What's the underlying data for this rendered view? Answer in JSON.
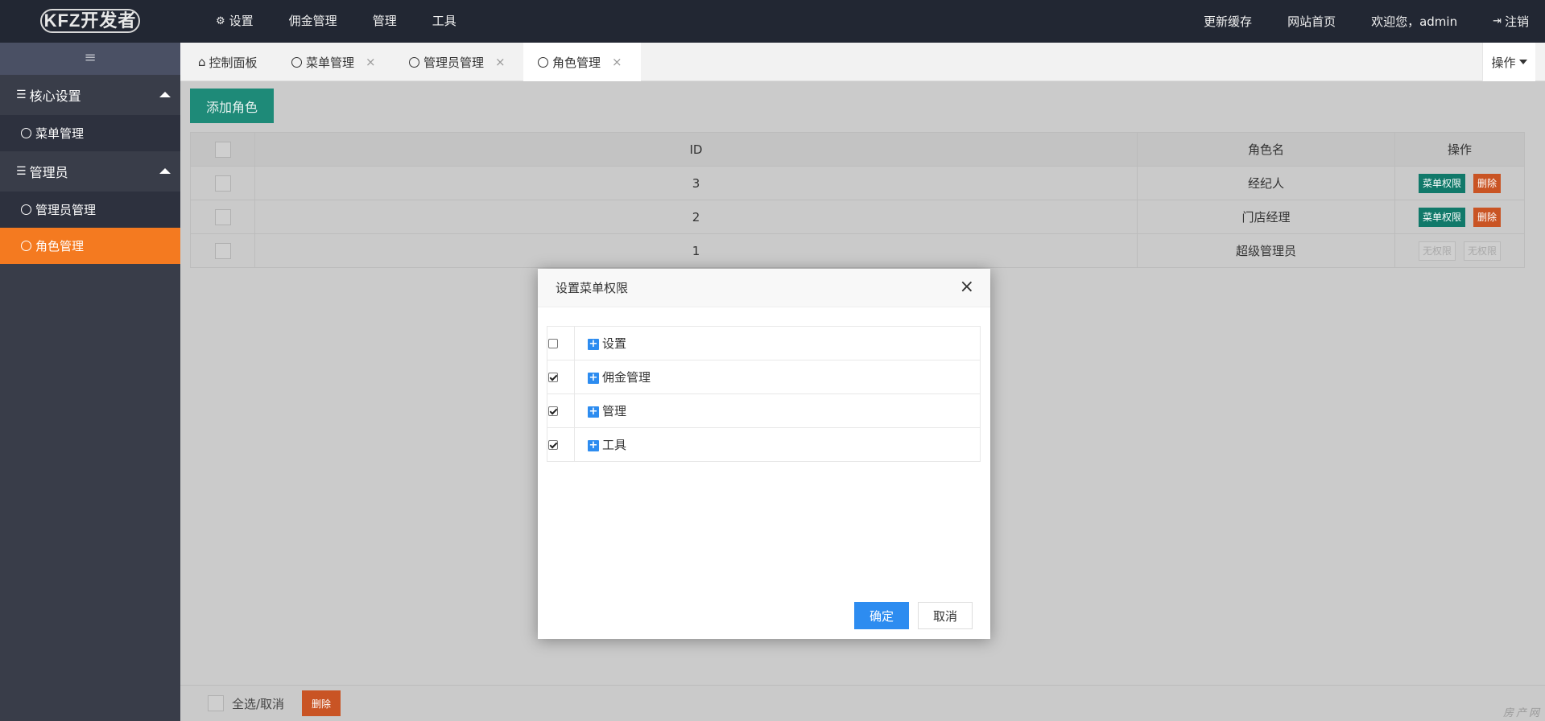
{
  "logo": "KFZ开发者",
  "topnav": [
    "设置",
    "佣金管理",
    "管理",
    "工具"
  ],
  "topright": {
    "refresh_cache": "更新缓存",
    "site_home": "网站首页",
    "welcome": "欢迎您，admin",
    "logout": "注销"
  },
  "sidebar": {
    "toggle": "≡",
    "groups": [
      {
        "label": "核心设置",
        "items": [
          "菜单管理"
        ]
      },
      {
        "label": "管理员",
        "items": [
          "管理员管理",
          "角色管理"
        ]
      }
    ],
    "active_item": "角色管理"
  },
  "tabs": [
    {
      "label": "控制面板",
      "closable": false
    },
    {
      "label": "菜单管理",
      "closable": true
    },
    {
      "label": "管理员管理",
      "closable": true
    },
    {
      "label": "角色管理",
      "closable": true,
      "active": true
    }
  ],
  "tab_close_glyph": "×",
  "op_menu": "操作",
  "add_role_label": "添加角色",
  "table": {
    "headers": [
      "ID",
      "角色名",
      "操作"
    ],
    "rows": [
      {
        "id": "3",
        "name": "经纪人",
        "actions": [
          "菜单权限",
          "删除"
        ],
        "disabled": false
      },
      {
        "id": "2",
        "name": "门店经理",
        "actions": [
          "菜单权限",
          "删除"
        ],
        "disabled": false
      },
      {
        "id": "1",
        "name": "超级管理员",
        "actions": [
          "无权限",
          "无权限"
        ],
        "disabled": true
      }
    ]
  },
  "footer": {
    "select_all": "全选/取消",
    "delete": "删除"
  },
  "watermark": "房产网",
  "modal": {
    "title": "设置菜单权限",
    "close": "×",
    "permissions": [
      {
        "label": "设置",
        "checked": false
      },
      {
        "label": "佣金管理",
        "checked": true
      },
      {
        "label": "管理",
        "checked": true
      },
      {
        "label": "工具",
        "checked": true
      }
    ],
    "ok": "确定",
    "cancel": "取消"
  },
  "colors": {
    "topbar": "#222733",
    "sidebar": "#393d49",
    "active_orange": "#f47a20",
    "teal": "#1e8a78",
    "danger": "#c95424",
    "primary_blue": "#2d8cf0"
  }
}
